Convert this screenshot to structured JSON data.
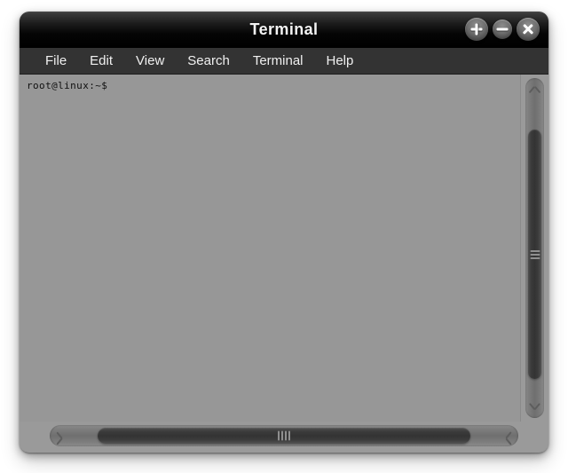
{
  "window": {
    "title": "Terminal",
    "buttons": [
      {
        "name": "maximize-button",
        "icon": "plus-icon",
        "label": "+"
      },
      {
        "name": "minimize-button",
        "icon": "minus-icon",
        "label": "−"
      },
      {
        "name": "close-button",
        "icon": "close-icon",
        "label": "✕"
      }
    ]
  },
  "menubar": {
    "items": [
      {
        "label": "File"
      },
      {
        "label": "Edit"
      },
      {
        "label": "View"
      },
      {
        "label": "Search"
      },
      {
        "label": "Terminal"
      },
      {
        "label": "Help"
      }
    ]
  },
  "terminal": {
    "background_color": "#979797",
    "text_color": "#101010",
    "lines": [
      "root@linux:~$"
    ],
    "prompt": "root@linux:~$",
    "user": "root",
    "host": "linux",
    "cwd": "~"
  },
  "scrollbars": {
    "vertical": {
      "up_arrow_icon": "chevron-up-icon",
      "down_arrow_icon": "chevron-down-icon",
      "grip_lines": 3
    },
    "horizontal": {
      "left_arrow_icon": "chevron-left-icon",
      "right_arrow_icon": "chevron-right-icon",
      "grip_lines": 4
    }
  },
  "colors": {
    "titlebar": "#000000",
    "menubar": "#333333",
    "frame": "#9a9a9a",
    "terminal_bg": "#979797",
    "scroll_thumb": "#333333",
    "desktop": "#ffffff"
  }
}
